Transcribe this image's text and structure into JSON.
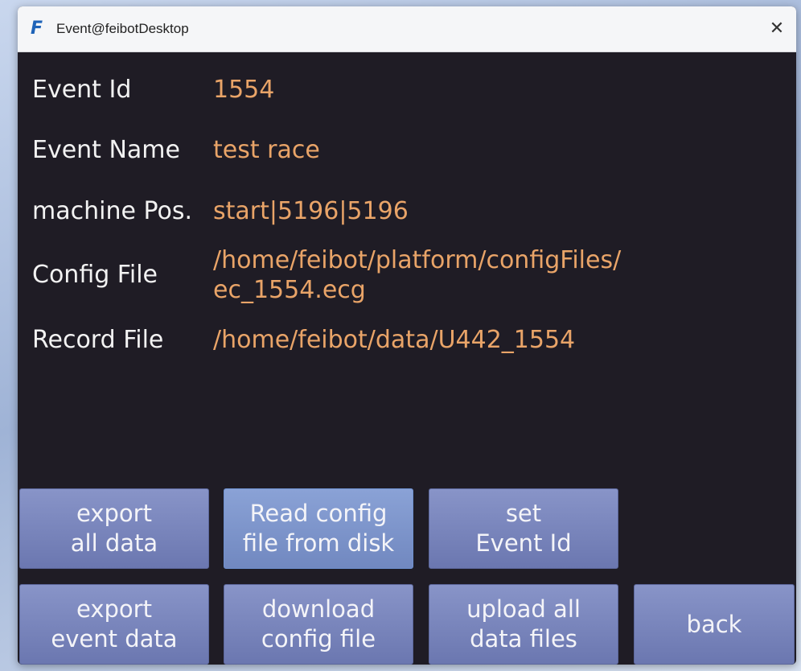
{
  "window": {
    "title": "Event@feibotDesktop",
    "logo_letter": "F",
    "close_glyph": "✕"
  },
  "fields": {
    "event_id": {
      "label": "Event Id",
      "value": "1554"
    },
    "event_name": {
      "label": "Event Name",
      "value": "test race"
    },
    "machine_pos": {
      "label": "machine Pos.",
      "value": "start|5196|5196"
    },
    "config_file": {
      "label": "Config File",
      "value_line1": "/home/feibot/platform/configFiles/",
      "value_line2": "ec_1554.ecg"
    },
    "record_file": {
      "label": "Record File",
      "value": "/home/feibot/data/U442_1554"
    }
  },
  "buttons": {
    "export_all": "export\nall data",
    "read_config": "Read config\nfile from disk",
    "set_event_id": "set\nEvent Id",
    "export_event": "export\nevent data",
    "download_config": "download\nconfig file",
    "upload_all": "upload all\ndata files",
    "back": "back"
  },
  "colors": {
    "background": "#1f1c25",
    "label": "#f2f2f2",
    "value": "#e9a468",
    "button": "#7680ba"
  }
}
